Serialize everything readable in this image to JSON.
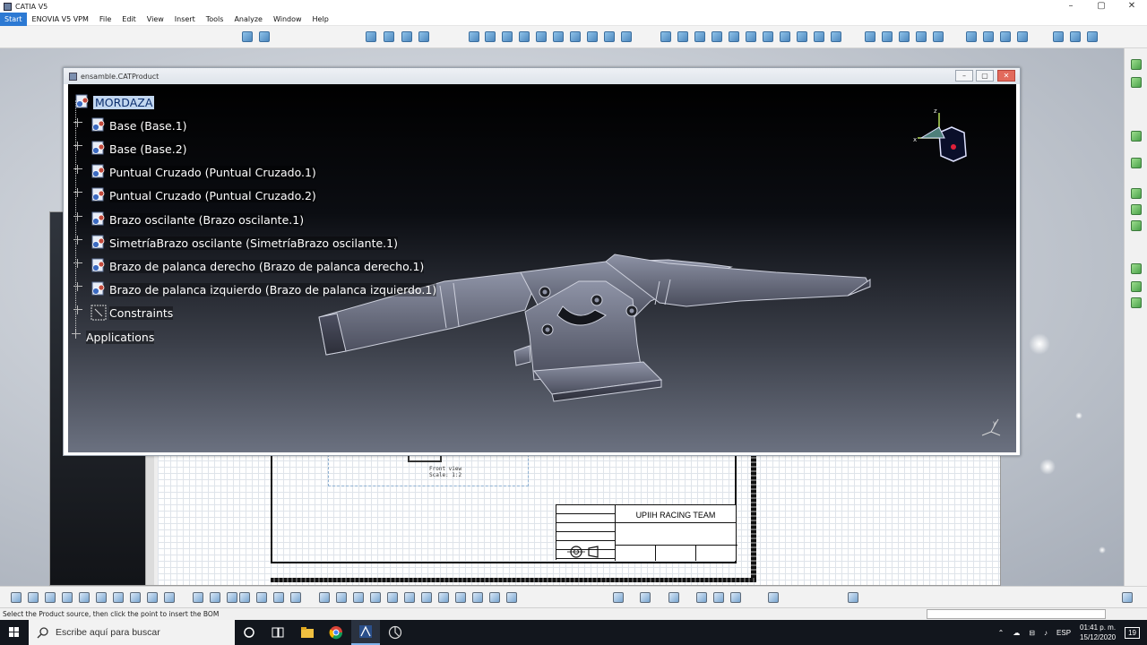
{
  "app": {
    "title": "CATIA V5",
    "window_controls": [
      "–",
      "▢",
      "✕"
    ]
  },
  "menubar": {
    "items": [
      "Start",
      "ENOVIA V5 VPM",
      "File",
      "Edit",
      "View",
      "Insert",
      "Tools",
      "Analyze",
      "Window",
      "Help"
    ]
  },
  "product_window": {
    "title": "ensamble.CATProduct",
    "tree": [
      {
        "label": "MORDAZA",
        "kind": "root"
      },
      {
        "label": "Base (Base.1)",
        "kind": "part"
      },
      {
        "label": "Base (Base.2)",
        "kind": "part"
      },
      {
        "label": "Puntual Cruzado (Puntual Cruzado.1)",
        "kind": "part"
      },
      {
        "label": "Puntual Cruzado (Puntual Cruzado.2)",
        "kind": "part"
      },
      {
        "label": "Brazo oscilante (Brazo oscilante.1)",
        "kind": "part"
      },
      {
        "label": "SimetríaBrazo oscilante (SimetríaBrazo oscilante.1)",
        "kind": "part"
      },
      {
        "label": "Brazo de palanca derecho (Brazo de palanca derecho.1)",
        "kind": "part"
      },
      {
        "label": "Brazo de palanca izquierdo (Brazo de palanca izquierdo.1)",
        "kind": "part"
      },
      {
        "label": "Constraints",
        "kind": "constraints"
      },
      {
        "label": "Applications",
        "kind": "applications"
      }
    ]
  },
  "drawing": {
    "front_view_label": "Front view",
    "front_view_scale": "Scale:  1:2",
    "team_name": "UPIIH RACING TEAM"
  },
  "status": {
    "message": "Select the Product source, then click the point to insert the BOM"
  },
  "taskbar": {
    "search_placeholder": "Escribe aquí para buscar",
    "language": "ESP",
    "time": "01:41 p. m.",
    "date": "15/12/2020",
    "notifications": "19"
  },
  "colors": {
    "selection": "#c2d7f0",
    "viewport_top": "#000000",
    "viewport_bottom": "#6b7180",
    "model_body": "#5a5d6e"
  },
  "icons": {
    "product": "product-icon",
    "part": "part-icon",
    "constraints": "constraints-icon",
    "compass": "compass-icon",
    "axis": "axis-icon"
  }
}
